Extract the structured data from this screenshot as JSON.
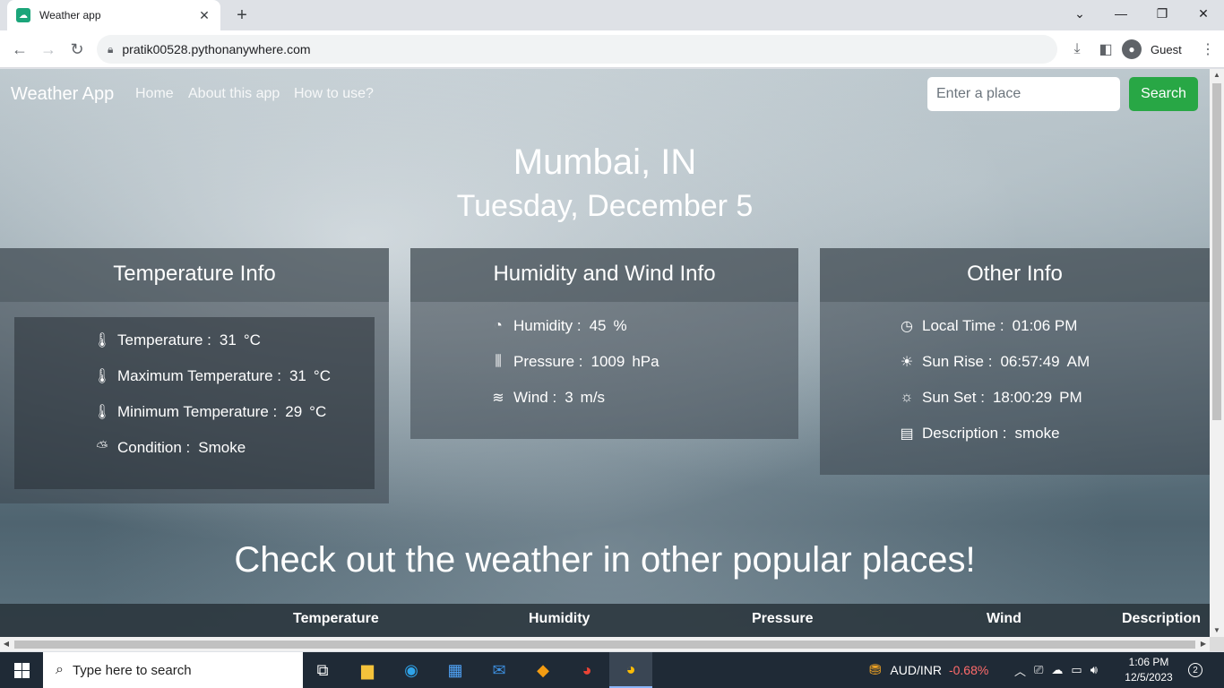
{
  "browser": {
    "tab_title": "Weather app",
    "url": "pratik00528.pythonanywhere.com",
    "profile_name": "Guest"
  },
  "nav": {
    "brand": "Weather App",
    "links": [
      "Home",
      "About this app",
      "How to use?"
    ],
    "search_placeholder": "Enter a place",
    "search_button": "Search"
  },
  "location": {
    "city": "Mumbai, IN",
    "date": "Tuesday, December 5"
  },
  "temperature_card": {
    "title": "Temperature Info",
    "rows": [
      {
        "label": "Temperature :",
        "value": "31",
        "unit": "°C"
      },
      {
        "label": "Maximum Temperature :",
        "value": "31",
        "unit": "°C"
      },
      {
        "label": "Minimum Temperature :",
        "value": "29",
        "unit": "°C"
      },
      {
        "label": "Condition :",
        "value": "Smoke",
        "unit": ""
      }
    ]
  },
  "humidity_card": {
    "title": "Humidity and Wind Info",
    "rows": [
      {
        "label": "Humidity :",
        "value": "45",
        "unit": "%"
      },
      {
        "label": "Pressure :",
        "value": "1009",
        "unit": "hPa"
      },
      {
        "label": "Wind :",
        "value": "3",
        "unit": "m/s"
      }
    ]
  },
  "other_card": {
    "title": "Other Info",
    "rows": [
      {
        "label": "Local Time :",
        "value": "01:06 PM",
        "unit": ""
      },
      {
        "label": "Sun Rise :",
        "value": "06:57:49",
        "unit": "AM"
      },
      {
        "label": "Sun Set :",
        "value": "18:00:29",
        "unit": "PM"
      },
      {
        "label": "Description :",
        "value": "smoke",
        "unit": ""
      }
    ]
  },
  "popular": {
    "heading": "Check out the weather in other popular places!",
    "columns": [
      "Temperature",
      "Humidity",
      "Pressure",
      "Wind",
      "Description"
    ]
  },
  "taskbar": {
    "search_placeholder": "Type here to search",
    "ticker_label": "AUD/INR",
    "ticker_change": "-0.68%",
    "time": "1:06 PM",
    "date": "12/5/2023",
    "notification_count": "2"
  },
  "colors": {
    "search_button": "#28a745",
    "ticker_negative": "#ff6b6b",
    "taskbar": "#1f2a36"
  }
}
